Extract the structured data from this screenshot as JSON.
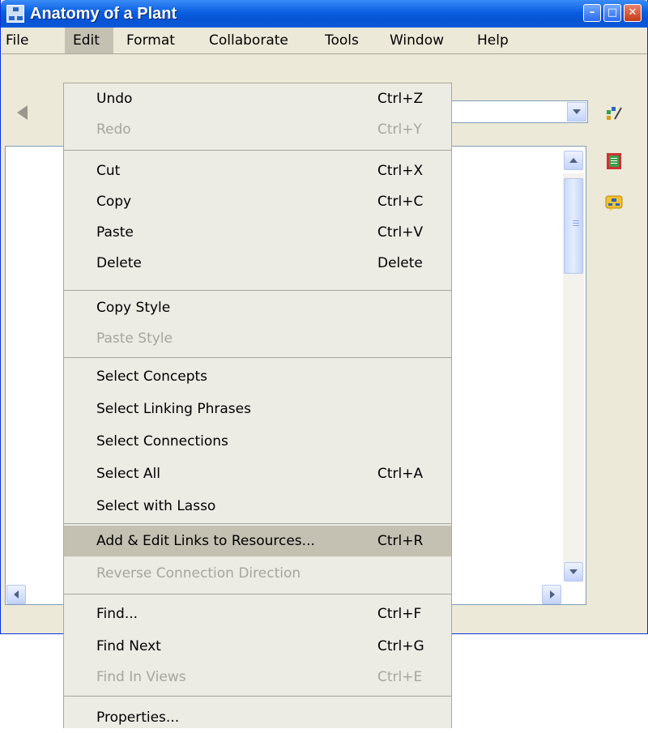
{
  "window": {
    "title": "Anatomy of a Plant",
    "caption_buttons": {
      "minimize": "–",
      "maximize": "□",
      "close": "✕"
    }
  },
  "menubar": [
    "File",
    "Edit",
    "Format",
    "Collaborate",
    "Tools",
    "Window",
    "Help"
  ],
  "active_menu": "Edit",
  "edit_menu": {
    "items": [
      {
        "label": "Undo",
        "shortcut": "Ctrl+Z",
        "enabled": true
      },
      {
        "label": "Redo",
        "shortcut": "Ctrl+Y",
        "enabled": false
      },
      {
        "label": "Cut",
        "shortcut": "Ctrl+X",
        "enabled": true
      },
      {
        "label": "Copy",
        "shortcut": "Ctrl+C",
        "enabled": true
      },
      {
        "label": "Paste",
        "shortcut": "Ctrl+V",
        "enabled": true
      },
      {
        "label": "Delete",
        "shortcut": "Delete",
        "enabled": true
      },
      {
        "label": "Copy Style",
        "shortcut": "",
        "enabled": true
      },
      {
        "label": "Paste Style",
        "shortcut": "",
        "enabled": false
      },
      {
        "label": "Select Concepts",
        "shortcut": "",
        "enabled": true
      },
      {
        "label": "Select Linking Phrases",
        "shortcut": "",
        "enabled": true
      },
      {
        "label": "Select Connections",
        "shortcut": "",
        "enabled": true
      },
      {
        "label": "Select All",
        "shortcut": "Ctrl+A",
        "enabled": true
      },
      {
        "label": "Select with Lasso",
        "shortcut": "",
        "enabled": true
      },
      {
        "label": "Add & Edit Links to Resources...",
        "shortcut": "Ctrl+R",
        "enabled": true,
        "highlighted": true
      },
      {
        "label": "Reverse Connection Direction",
        "shortcut": "",
        "enabled": false
      },
      {
        "label": "Find...",
        "shortcut": "Ctrl+F",
        "enabled": true
      },
      {
        "label": "Find Next",
        "shortcut": "Ctrl+G",
        "enabled": true
      },
      {
        "label": "Find In Views",
        "shortcut": "Ctrl+E",
        "enabled": false
      },
      {
        "label": "Properties...",
        "shortcut": "",
        "enabled": true
      }
    ]
  },
  "icons": {
    "toolbar": [
      "back-arrow-icon",
      "dropdown-arrow-icon"
    ],
    "side_panel": [
      "style-palette-icon",
      "list-view-icon",
      "collaboration-icon"
    ]
  },
  "colors": {
    "titlebar": "#0a5fe0",
    "menu_highlight": "#c4c1b3",
    "disabled_text": "#a7a69c"
  }
}
